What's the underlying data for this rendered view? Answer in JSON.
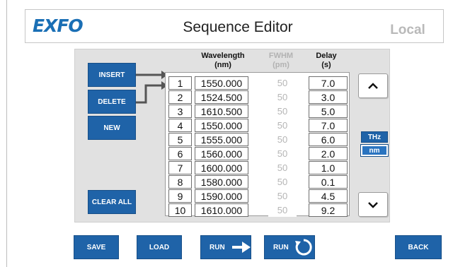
{
  "header": {
    "logo": "EXFO",
    "title": "Sequence Editor",
    "mode": "Local"
  },
  "buttons": {
    "insert": "INSERT",
    "delete": "DELETE",
    "new": "NEW",
    "clear_all": "CLEAR ALL"
  },
  "columns": {
    "wavelength": "Wavelength",
    "wavelength_unit": "(nm)",
    "fwhm": "FWHM",
    "fwhm_unit": "(pm)",
    "delay": "Delay",
    "delay_unit": "(s)"
  },
  "rows": [
    {
      "index": "1",
      "wavelength": "1550.000",
      "fwhm": "50",
      "delay": "7.0"
    },
    {
      "index": "2",
      "wavelength": "1524.500",
      "fwhm": "50",
      "delay": "3.0"
    },
    {
      "index": "3",
      "wavelength": "1610.500",
      "fwhm": "50",
      "delay": "5.0"
    },
    {
      "index": "4",
      "wavelength": "1550.000",
      "fwhm": "50",
      "delay": "7.0"
    },
    {
      "index": "5",
      "wavelength": "1555.000",
      "fwhm": "50",
      "delay": "6.0"
    },
    {
      "index": "6",
      "wavelength": "1560.000",
      "fwhm": "50",
      "delay": "2.0"
    },
    {
      "index": "7",
      "wavelength": "1600.000",
      "fwhm": "50",
      "delay": "1.0"
    },
    {
      "index": "8",
      "wavelength": "1580.000",
      "fwhm": "50",
      "delay": "0.1"
    },
    {
      "index": "9",
      "wavelength": "1590.000",
      "fwhm": "50",
      "delay": "4.5"
    },
    {
      "index": "10",
      "wavelength": "1610.000",
      "fwhm": "50",
      "delay": "9.2"
    }
  ],
  "units": {
    "thz": "THz",
    "nm": "nm",
    "selected": "nm"
  },
  "footer": {
    "save": "SAVE",
    "load": "LOAD",
    "run": "RUN",
    "run_loop": "RUN",
    "back": "BACK"
  },
  "colors": {
    "accent": "#1f63a8",
    "logo": "#1a6fb5",
    "disabled_text": "#b5b5b5"
  },
  "icons": {
    "up": "chevron-up-icon",
    "down": "chevron-down-icon",
    "run": "arrow-right-icon",
    "loop": "loop-icon"
  }
}
